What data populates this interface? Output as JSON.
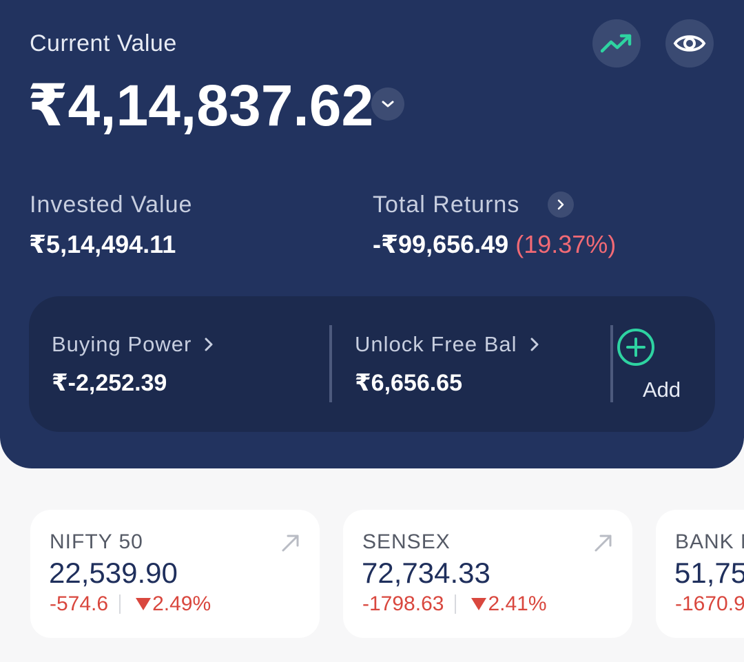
{
  "portfolio": {
    "current_value_label": "Current Value",
    "current_value": "₹4,14,837.62",
    "invested_label": "Invested Value",
    "invested_value": "₹5,14,494.11",
    "returns_label": "Total Returns",
    "returns_value": "-₹99,656.49",
    "returns_pct": "(19.37%)"
  },
  "funds": {
    "buying_power_label": "Buying Power",
    "buying_power_value": "₹-2,252.39",
    "unlock_label": "Unlock Free Bal",
    "unlock_value": "₹6,656.65",
    "add_label": "Add"
  },
  "indices": [
    {
      "name": "NIFTY 50",
      "value": "22,539.90",
      "change": "-574.6",
      "pct": "2.49%"
    },
    {
      "name": "SENSEX",
      "value": "72,734.33",
      "change": "-1798.63",
      "pct": "2.41%"
    },
    {
      "name": "BANK NIFTY",
      "value": "51,75",
      "change": "-1670.9"
    }
  ],
  "icons": {
    "trend": "trending-up-icon",
    "eye": "eye-icon",
    "chevron": "chevron-down-icon",
    "arrow": "arrow-up-right-icon",
    "add": "plus-circle-icon"
  },
  "colors": {
    "hero_bg": "#22335f",
    "card_bg": "#1c2a4e",
    "accent_green": "#2ed3a1",
    "negative_red": "#d9473e",
    "returns_pink": "#f26a75"
  }
}
